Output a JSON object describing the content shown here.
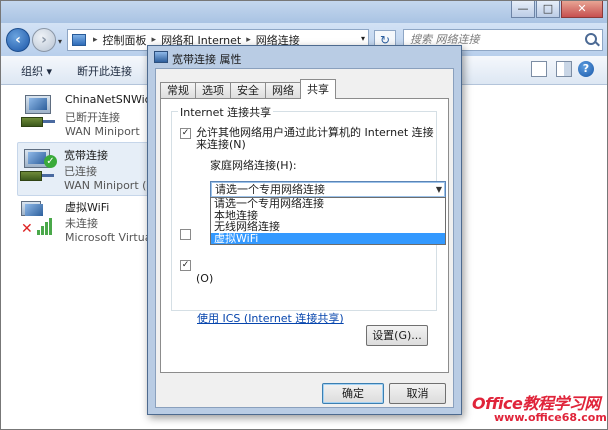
{
  "explorer": {
    "breadcrumb": [
      "控制面板",
      "网络和 Internet",
      "网络连接"
    ],
    "search_placeholder": "搜索 网络连接",
    "toolbar": {
      "organize": "组织 ▾",
      "disconnect": "断开此连接"
    },
    "window_buttons": {
      "minimize": "—",
      "maximize": "□",
      "close": "✕"
    },
    "connections": [
      {
        "name": "ChinaNetSNWide",
        "status": "已断开连接",
        "device": "WAN Miniport"
      },
      {
        "name": "宽带连接",
        "status": "已连接",
        "device": "WAN Miniport (P"
      },
      {
        "name": "虚拟WiFi",
        "status": "未连接",
        "device": "Microsoft Virtual"
      }
    ]
  },
  "dialog": {
    "title": "宽带连接 属性",
    "tabs": [
      "常规",
      "选项",
      "安全",
      "网络",
      "共享"
    ],
    "active_tab": "共享",
    "group_title": "Internet 连接共享",
    "allow_sharing_line1": "允许其他网络用户通过此计算机的 Internet 连接",
    "allow_sharing_line2": "来连接(N)",
    "allow_sharing_checked": true,
    "home_network_label": "家庭网络连接(H):",
    "combo_value": "请选一个专用网络连接",
    "dropdown_options": [
      "请选一个专用网络连接",
      "本地连接",
      "无线网络连接",
      "虚拟WiFi"
    ],
    "selected_option_index": 3,
    "second_checkbox_checked": false,
    "third_checkbox_checked": true,
    "third_checkbox_label": "(O)",
    "ics_link": "使用 ICS (Internet 连接共享)",
    "settings_button": "设置(G)...",
    "ok_button": "确定",
    "cancel_button": "取消"
  },
  "watermark": {
    "brand": "Office教程学习网",
    "url": "www.office68.com"
  },
  "colors": {
    "selection": "#3399ff",
    "link": "#0645ad",
    "watermark": "#e0243a"
  }
}
